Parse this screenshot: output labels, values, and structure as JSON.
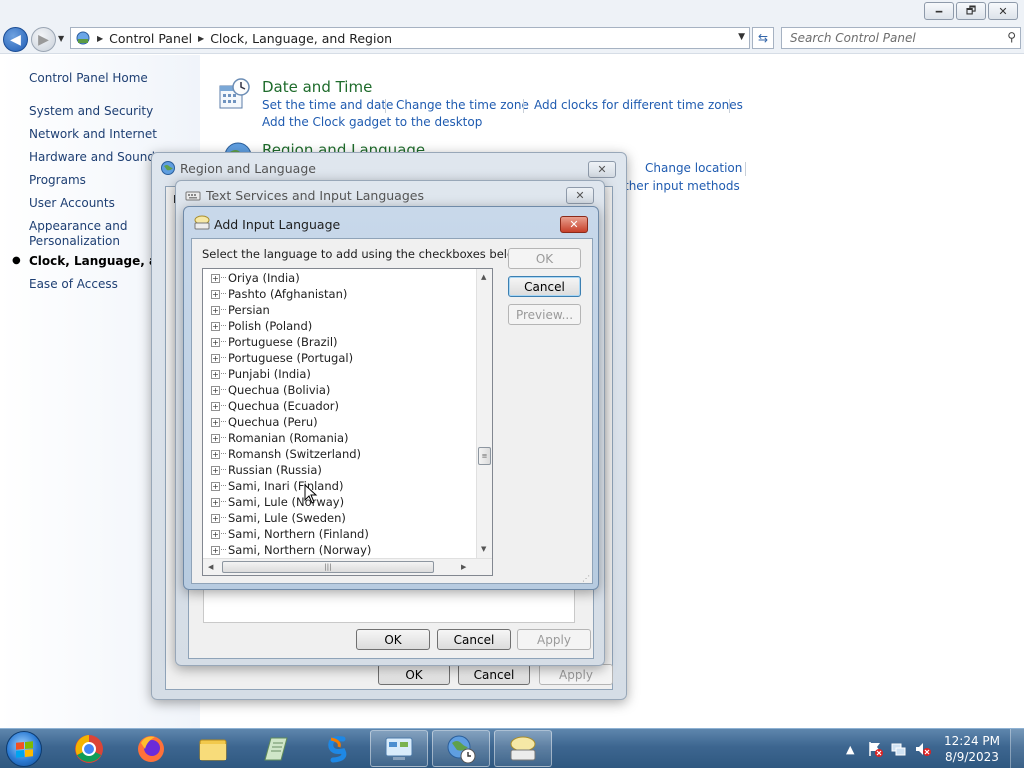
{
  "window": {
    "minimize_glyph": "🗕",
    "maximize_glyph": "🗗",
    "close_glyph": "✕"
  },
  "address": {
    "crumbs": [
      "Control Panel",
      "Clock, Language, and Region"
    ],
    "search_placeholder": "Search Control Panel"
  },
  "left_nav": {
    "home": "Control Panel Home",
    "items": [
      "System and Security",
      "Network and Internet",
      "Hardware and Sound",
      "Programs",
      "User Accounts",
      "Appearance and",
      "Personalization",
      "Clock, Language, and I",
      "Ease of Access"
    ]
  },
  "main": {
    "date_time": {
      "title": "Date and Time",
      "links": [
        "Set the time and date",
        "Change the time zone",
        "Add clocks for different time zones",
        "Add the Clock gadget to the desktop"
      ]
    },
    "region_language": {
      "title": "Region and Language",
      "links": [
        "Change location",
        "ther input methods"
      ]
    }
  },
  "region_dialog": {
    "title": "Region and Language",
    "tab_stub": "K",
    "ok": "OK",
    "cancel": "Cancel",
    "apply": "Apply"
  },
  "text_services_dialog": {
    "title": "Text Services and Input Languages",
    "ok": "OK",
    "cancel": "Cancel",
    "apply": "Apply"
  },
  "add_input_dialog": {
    "title": "Add Input Language",
    "instruction": "Select the language to add using the checkboxes below.",
    "ok": "OK",
    "cancel": "Cancel",
    "preview": "Preview...",
    "languages": [
      "Oriya (India)",
      "Pashto (Afghanistan)",
      "Persian",
      "Polish (Poland)",
      "Portuguese (Brazil)",
      "Portuguese (Portugal)",
      "Punjabi (India)",
      "Quechua (Bolivia)",
      "Quechua (Ecuador)",
      "Quechua (Peru)",
      "Romanian (Romania)",
      "Romansh (Switzerland)",
      "Russian (Russia)",
      "Sami, Inari (Finland)",
      "Sami, Lule (Norway)",
      "Sami, Lule (Sweden)",
      "Sami, Northern (Finland)",
      "Sami, Northern (Norway)"
    ]
  },
  "taskbar": {
    "time": "12:24 PM",
    "date": "8/9/2023",
    "tray_up_arrow": "▲"
  },
  "colors": {
    "link": "#1f5bb0",
    "section_title": "#1e6b2b",
    "taskbar": "#3d6690"
  }
}
